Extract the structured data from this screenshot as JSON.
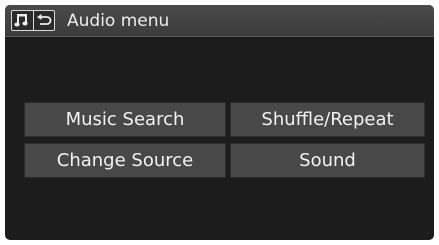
{
  "header": {
    "title": "Audio menu",
    "icons": [
      "music-note-icon",
      "back-arrow-icon"
    ]
  },
  "menu": {
    "items": [
      {
        "label": "Music Search"
      },
      {
        "label": "Shuffle/Repeat"
      },
      {
        "label": "Change Source"
      },
      {
        "label": "Sound"
      }
    ]
  },
  "colors": {
    "screen_background": "#1c1c1c",
    "title_bar": "#424242",
    "button_background": "#484848",
    "text": "#f2f2f2"
  }
}
